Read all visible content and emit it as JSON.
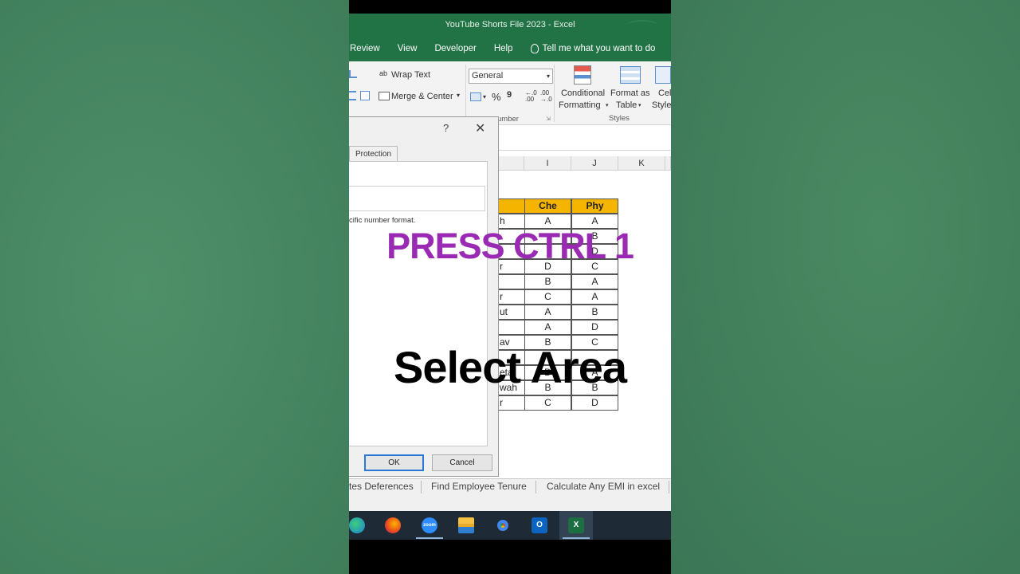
{
  "window": {
    "title": "YouTube Shorts File 2023  -  Excel"
  },
  "menu": {
    "items": [
      "Review",
      "View",
      "Developer",
      "Help"
    ],
    "tell_me": "Tell me what you want to do"
  },
  "ribbon": {
    "wrap_text": "Wrap Text",
    "merge_center": "Merge & Center",
    "number_format": "General",
    "percent": "%",
    "comma": "9",
    "group_number": "umber",
    "conditional_line1": "Conditional",
    "conditional_line2": "Formatting",
    "format_table_line1": "Format as",
    "format_table_line2": "Table",
    "cell_styles_line1": "Cell",
    "cell_styles_line2": "Styles",
    "group_styles": "Styles"
  },
  "columns": [
    "I",
    "J",
    "K"
  ],
  "table": {
    "headers": [
      "Che",
      "Phy"
    ],
    "rows": [
      {
        "name": "h",
        "che": "A",
        "phy": "A"
      },
      {
        "name": "",
        "che": "",
        "phy": "B"
      },
      {
        "name": "",
        "che": "",
        "phy": "D"
      },
      {
        "name": "r",
        "che": "D",
        "phy": "C"
      },
      {
        "name": "",
        "che": "B",
        "phy": "A"
      },
      {
        "name": "r",
        "che": "C",
        "phy": "A"
      },
      {
        "name": "ut",
        "che": "A",
        "phy": "B"
      },
      {
        "name": "",
        "che": "A",
        "phy": "D"
      },
      {
        "name": "av",
        "che": "B",
        "phy": "C"
      },
      {
        "name": "",
        "che": "",
        "phy": ""
      },
      {
        "name": "eta",
        "che": "D",
        "phy": "A"
      },
      {
        "name": "wah",
        "che": "B",
        "phy": "B"
      },
      {
        "name": "r",
        "che": "C",
        "phy": "D"
      }
    ]
  },
  "dialog": {
    "help": "?",
    "close": "✕",
    "tab_protection": "Protection",
    "description": "cific number format.",
    "ok": "OK",
    "cancel": "Cancel"
  },
  "sheet_tabs": [
    "tes Deferences",
    "Find Employee Tenure",
    "Calculate Any EMI in excel"
  ],
  "taskbar": {
    "icons": [
      "edge-icon",
      "firefox-icon",
      "zoom-icon",
      "file-explorer-icon",
      "chrome-icon",
      "outlook-icon",
      "excel-icon"
    ],
    "zoom_label": "zoom"
  },
  "overlay": {
    "press": "PRESS CTRL 1",
    "select": "Select Area"
  },
  "colors": {
    "excel_green": "#217346",
    "header_fill": "#f5b400",
    "overlay_purple": "#9a2ab4"
  }
}
